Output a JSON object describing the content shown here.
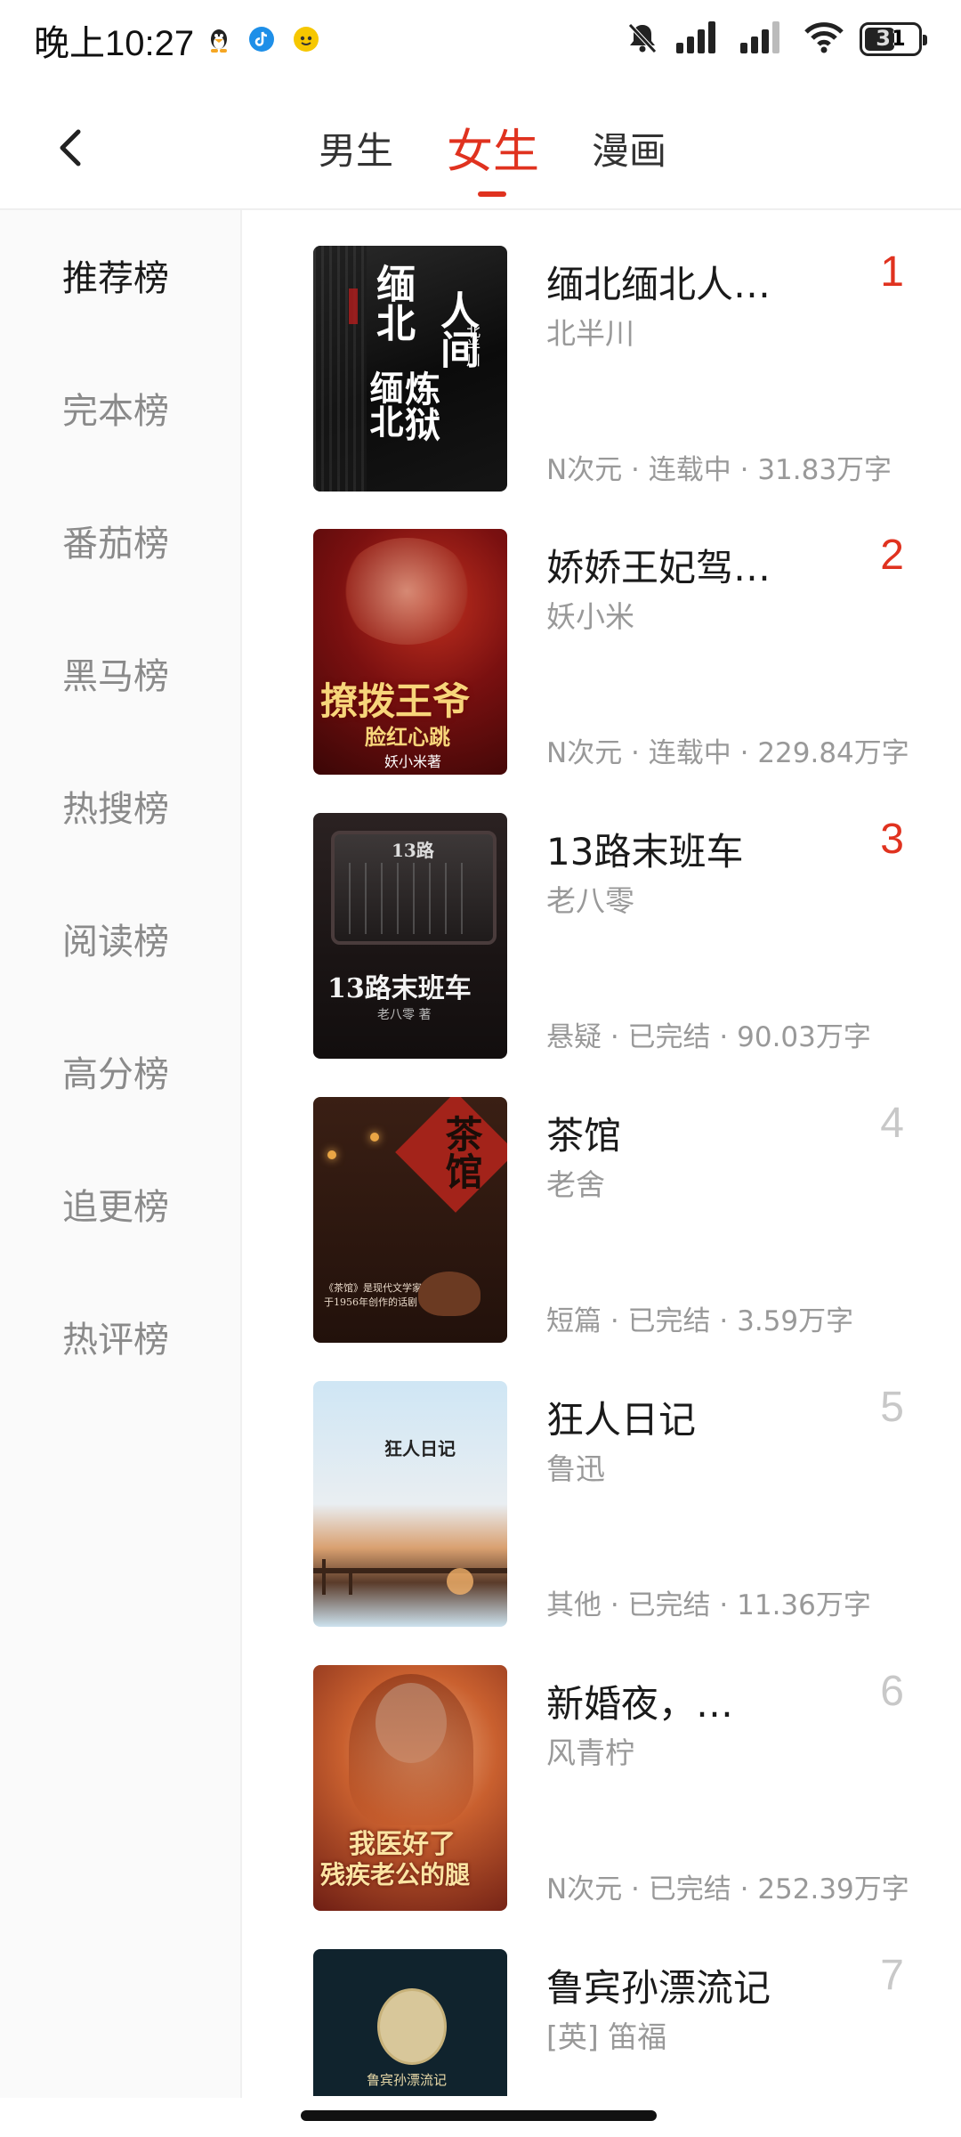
{
  "status_bar": {
    "time": "晚上10:27",
    "battery": "31",
    "icons": [
      "qq-icon",
      "tiktok-icon",
      "app-icon",
      "mute-icon",
      "signal-icon",
      "signal-icon",
      "wifi-icon",
      "battery-icon"
    ]
  },
  "header": {
    "back_icon": "back-chevron-icon",
    "tabs": [
      {
        "label": "男生",
        "active": false
      },
      {
        "label": "女生",
        "active": true
      },
      {
        "label": "漫画",
        "active": false
      }
    ]
  },
  "sidebar": {
    "items": [
      {
        "label": "推荐榜",
        "active": true
      },
      {
        "label": "完本榜",
        "active": false
      },
      {
        "label": "番茄榜",
        "active": false
      },
      {
        "label": "黑马榜",
        "active": false
      },
      {
        "label": "热搜榜",
        "active": false
      },
      {
        "label": "阅读榜",
        "active": false
      },
      {
        "label": "高分榜",
        "active": false
      },
      {
        "label": "追更榜",
        "active": false
      },
      {
        "label": "热评榜",
        "active": false
      }
    ]
  },
  "books": [
    {
      "title": "缅北缅北人…",
      "author": "北半川",
      "meta": "N次元 · 连载中 · 31.83万字",
      "rank": "1",
      "cover_text": [
        "缅北",
        "人间",
        "缅北",
        "炼狱"
      ],
      "cover_author": "北半川"
    },
    {
      "title": "娇娇王妃驾…",
      "author": "妖小米",
      "meta": "N次元 · 连载中 · 229.84万字",
      "rank": "2",
      "cover_text": [
        "撩拨王爷",
        "脸红心跳",
        "妖小米著"
      ]
    },
    {
      "title": "13路末班车",
      "author": "老八零",
      "meta": "悬疑 · 已完结 · 90.03万字",
      "rank": "3",
      "cover_text": [
        "13路",
        "13路末班车",
        "老八零 著"
      ]
    },
    {
      "title": "茶馆",
      "author": "老舍",
      "meta": "短篇 · 已完结 · 3.59万字",
      "rank": "4",
      "cover_text": [
        "茶馆",
        "《茶馆》是现代文学家老舍",
        "于1956年创作的话剧"
      ]
    },
    {
      "title": "狂人日记",
      "author": "鲁迅",
      "meta": "其他 · 已完结 · 11.36万字",
      "rank": "5",
      "cover_text": [
        "狂人日记"
      ]
    },
    {
      "title": "新婚夜，…",
      "author": "风青柠",
      "meta": "N次元 · 已完结 · 252.39万字",
      "rank": "6",
      "cover_text": [
        "我医好了",
        "残疾老公的腿"
      ]
    },
    {
      "title": "鲁宾孙漂流记",
      "author": "[英] 笛福",
      "meta": "",
      "rank": "7",
      "cover_text": [
        "鲁宾孙漂流记"
      ]
    }
  ],
  "colors": {
    "accent": "#e0321f",
    "muted": "#999999",
    "rank_gray": "#c8c8c8"
  }
}
